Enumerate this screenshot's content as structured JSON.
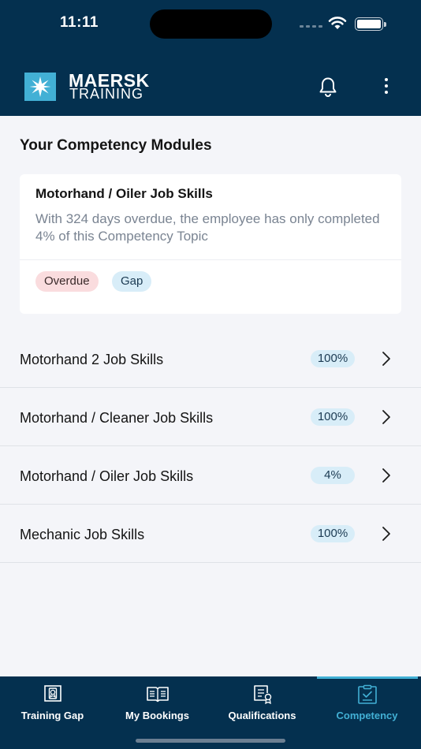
{
  "status_bar": {
    "time": "11:11"
  },
  "header": {
    "logo_line1": "MAERSK",
    "logo_line2": "TRAINING",
    "icons": [
      "bell-icon",
      "more-vertical-icon"
    ]
  },
  "main": {
    "title": "Your Competency Modules",
    "featured": {
      "title": "Motorhand / Oiler Job Skills",
      "description": "With 324 days overdue, the employee has only completed 4% of this Competency Topic",
      "badges": [
        "Overdue",
        "Gap"
      ]
    },
    "modules": [
      {
        "label": "Motorhand 2 Job Skills",
        "progress": "100%"
      },
      {
        "label": "Motorhand / Cleaner Job Skills",
        "progress": "100%"
      },
      {
        "label": "Motorhand / Oiler Job Skills",
        "progress": "4%"
      },
      {
        "label": "Mechanic Job Skills",
        "progress": "100%"
      }
    ]
  },
  "tabs": [
    {
      "label": "Training Gap",
      "icon": "training-gap-icon",
      "active": false
    },
    {
      "label": "My Bookings",
      "icon": "book-icon",
      "active": false
    },
    {
      "label": "Qualifications",
      "icon": "certificate-icon",
      "active": false
    },
    {
      "label": "Competency",
      "icon": "clipboard-check-icon",
      "active": true
    }
  ],
  "colors": {
    "header_bg": "#04304f",
    "accent": "#42b0d5",
    "overdue_bg": "#fadcde",
    "pill_bg": "#d8edf8"
  }
}
